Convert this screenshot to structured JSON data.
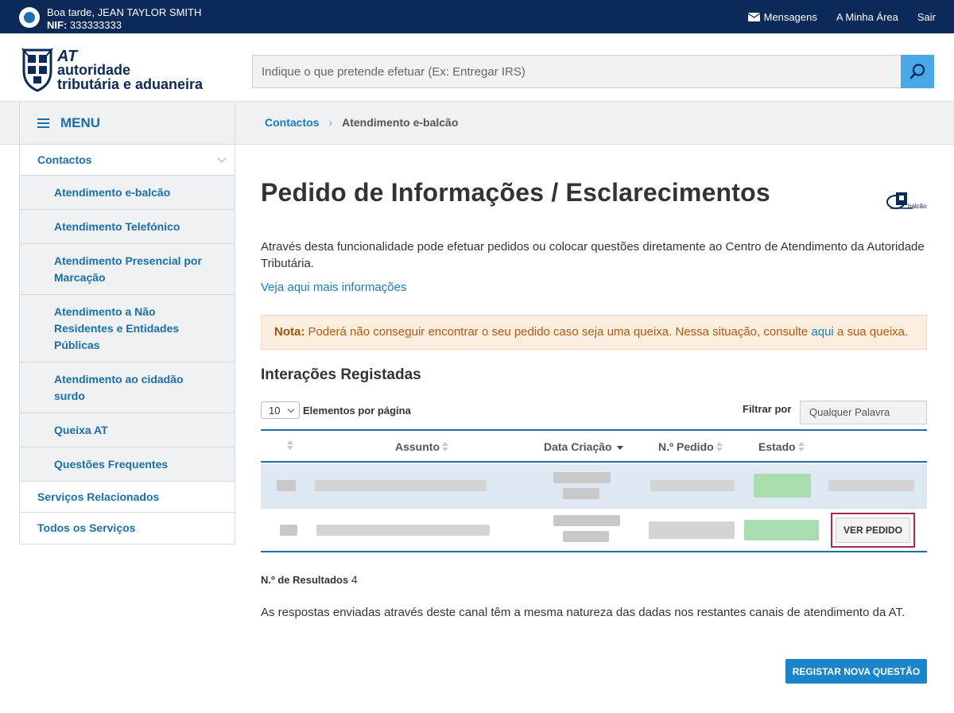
{
  "topbar": {
    "greeting": "Boa tarde, JEAN TAYLOR SMITH",
    "nif_label": "NIF:",
    "nif_value": "333333333",
    "messages": "Mensagens",
    "my_area": "A Minha Área",
    "logout": "Sair"
  },
  "logo": {
    "at": "AT",
    "line1": "autoridade",
    "line2": "tributária e aduaneira"
  },
  "search": {
    "placeholder": "Indique o que pretende efetuar (Ex: Entregar IRS)"
  },
  "menu": {
    "label": "MENU"
  },
  "breadcrumb": {
    "parent": "Contactos",
    "separator": "›",
    "current": "Atendimento e-balcão"
  },
  "sidebar": {
    "items": [
      {
        "label": "Contactos"
      },
      {
        "label": "Atendimento e-balcão"
      },
      {
        "label": "Atendimento Telefónico"
      },
      {
        "label": "Atendimento Presencial por Marcação"
      },
      {
        "label": "Atendimento a Não Residentes e Entidades Públicas"
      },
      {
        "label": "Atendimento ao cidadão surdo"
      },
      {
        "label": "Queixa AT"
      },
      {
        "label": "Questões Frequentes"
      },
      {
        "label": "Serviços Relacionados"
      },
      {
        "label": "Todos os Serviços"
      }
    ]
  },
  "main": {
    "title": "Pedido de Informações / Esclarecimentos",
    "badge_text": "balcão",
    "intro": "Através desta funcionalidade pode efetuar pedidos ou colocar questões diretamente ao Centro de Atendimento da Autoridade Tributária.",
    "more_link": "Veja aqui mais informações",
    "note_label": "Nota:",
    "note_text": "Poderá não conseguir encontrar o seu pedido caso seja uma queixa. Nessa situação, consulte",
    "note_link": "aqui",
    "note_end": "a sua queixa.",
    "section_title": "Interações Registadas",
    "per_page_value": "10",
    "per_page_label": "Elementos por página",
    "filter_label": "Filtrar por",
    "filter_placeholder": "Qualquer Palavra",
    "columns": [
      "Assunto",
      "Data Criação",
      "N.º Pedido",
      "Estado"
    ],
    "view_button": "VER PEDIDO",
    "results_label": "N.º de Resultados",
    "results_value": "4",
    "answers_text": "As respostas enviadas através deste canal têm a mesma natureza das dadas nos restantes canais de atendimento da AT.",
    "register_button": "REGISTAR NOVA QUESTÃO"
  },
  "colors": {
    "topbar": "#0b2a5a",
    "link": "#1a7cb8",
    "accent": "#1a6fa8",
    "note_bg": "#fbeedf",
    "highlight": "#a82a5a",
    "primary_button": "#1c84c9"
  }
}
